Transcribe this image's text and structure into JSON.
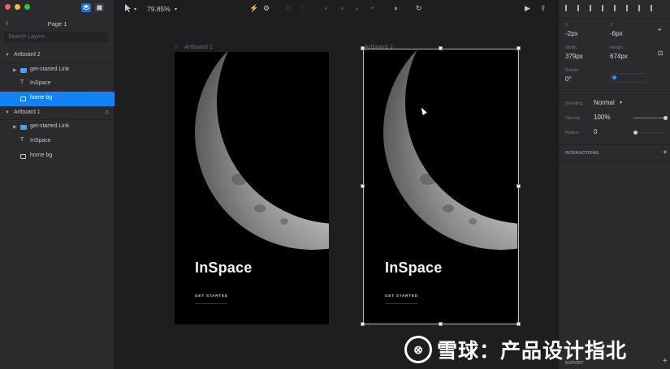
{
  "left": {
    "page_title": "Page 1",
    "search_placeholder": "Search Layers",
    "layers": [
      {
        "label": "Artboard 2"
      },
      {
        "label": "get-started Link"
      },
      {
        "label": "InSpace"
      },
      {
        "label": "home bg"
      },
      {
        "label": "Artboard 1"
      },
      {
        "label": "get-started Link"
      },
      {
        "label": "InSpace"
      },
      {
        "label": "home bg"
      }
    ]
  },
  "toolbar": {
    "zoom": "79.85%"
  },
  "canvas": {
    "artboard1_label": "Artboard 1",
    "artboard2_label": "Artboard 2",
    "app_title": "InSpace",
    "app_cta": "GET STARTED"
  },
  "right": {
    "x_label": "X",
    "x_value": "-2px",
    "y_label": "Y",
    "y_value": "-6px",
    "width_label": "Width",
    "width_value": "379px",
    "height_label": "Height",
    "height_value": "674px",
    "rotate_label": "Rotate",
    "rotate_value": "0°",
    "blending_label": "Blending",
    "blending_value": "Normal",
    "opacity_label": "Opacity",
    "opacity_value": "100%",
    "radius_label": "Radius",
    "radius_value": "0",
    "interactions_label": "INTERACTIONS",
    "export_label": "EXPORT"
  },
  "watermark": {
    "text": "雪球：产品设计指北"
  },
  "colors": {
    "accent": "#1282f5",
    "panel": "#2b2b2e",
    "canvas": "#1e1e20"
  }
}
